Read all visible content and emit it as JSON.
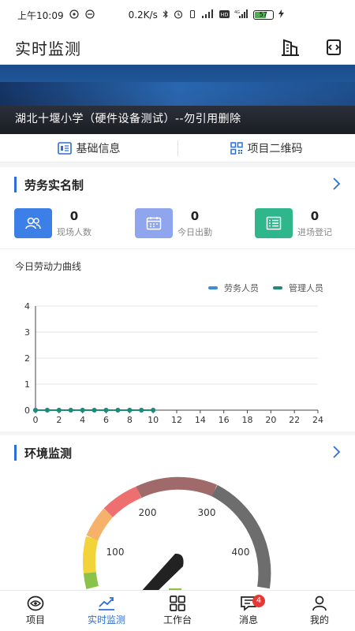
{
  "status_bar": {
    "time": "上午10:09",
    "net_speed": "0.2K/s",
    "battery": "57"
  },
  "header": {
    "title": "实时监测"
  },
  "banner": {
    "caption": "湖北十堰小学（硬件设备测试）--勿引用删除"
  },
  "info_bar": {
    "basic_info": "基础信息",
    "qr_code": "项目二维码"
  },
  "labor": {
    "title": "劳务实名制",
    "stats": [
      {
        "value": "0",
        "label": "现场人数",
        "color": "#3c7fe6"
      },
      {
        "value": "0",
        "label": "今日出勤",
        "color": "#8fa6ee"
      },
      {
        "value": "0",
        "label": "进场登记",
        "color": "#2fb68a"
      }
    ],
    "chart_title": "今日劳动力曲线"
  },
  "chart_data": {
    "type": "line",
    "title": "今日劳动力曲线",
    "x": [
      0,
      1,
      2,
      3,
      4,
      5,
      6,
      7,
      8,
      9,
      10
    ],
    "x_ticks": [
      "0",
      "2",
      "4",
      "6",
      "8",
      "10",
      "12",
      "14",
      "16",
      "18",
      "20",
      "22",
      "24"
    ],
    "y_ticks": [
      "0",
      "1",
      "2",
      "3",
      "4"
    ],
    "xlim": [
      0,
      24
    ],
    "ylim": [
      0,
      4
    ],
    "series": [
      {
        "name": "劳务人员",
        "color": "#3a8fd8",
        "values": [
          0,
          0,
          0,
          0,
          0,
          0,
          0,
          0,
          0,
          0,
          0
        ]
      },
      {
        "name": "管理人员",
        "color": "#1f8a78",
        "values": [
          0,
          0,
          0,
          0,
          0,
          0,
          0,
          0,
          0,
          0,
          0
        ]
      }
    ],
    "grid": true,
    "legend": "top-right"
  },
  "environment": {
    "title": "环境监测",
    "gauge_labels": [
      "100",
      "200",
      "300",
      "400"
    ]
  },
  "tabs": [
    {
      "label": "项目",
      "icon": "project-icon"
    },
    {
      "label": "实时监测",
      "icon": "trend-icon",
      "active": true
    },
    {
      "label": "工作台",
      "icon": "grid-icon"
    },
    {
      "label": "消息",
      "icon": "message-icon",
      "badge": "4"
    },
    {
      "label": "我的",
      "icon": "user-icon"
    }
  ]
}
